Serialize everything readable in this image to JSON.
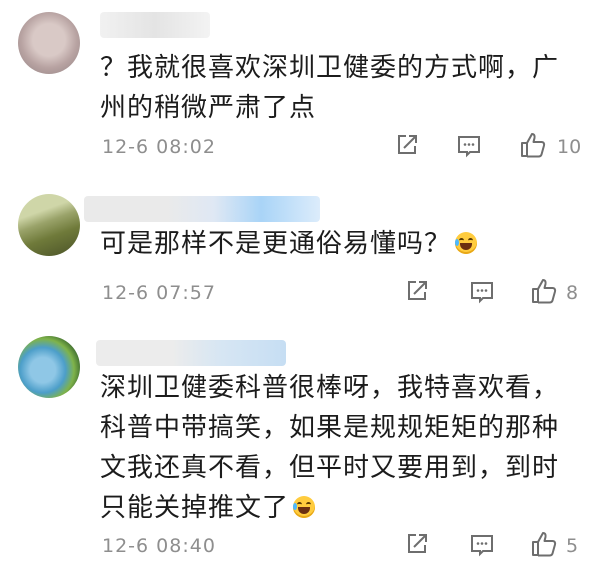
{
  "comments": [
    {
      "text": "？我就很喜欢深圳卫健委的方式啊，广州的稍微严肃了点",
      "time": "12-6 08:02",
      "likes": "10",
      "has_emoji": false
    },
    {
      "text": "可是那样不是更通俗易懂吗？",
      "time": "12-6 07:57",
      "likes": "8",
      "has_emoji": true
    },
    {
      "text": "深圳卫健委科普很棒呀，我特喜欢看，科普中带搞笑，如果是规规矩矩的那种文我还真不看，但平时又要用到，到时只能关掉推文了",
      "time": "12-6 08:40",
      "likes": "5",
      "has_emoji": true
    }
  ],
  "icons": [
    "share-icon",
    "reply-icon",
    "like-icon"
  ],
  "colors": {
    "meta": "#8e8e8e",
    "text": "#1c1c1c",
    "emoji": "#ffcc3e"
  }
}
